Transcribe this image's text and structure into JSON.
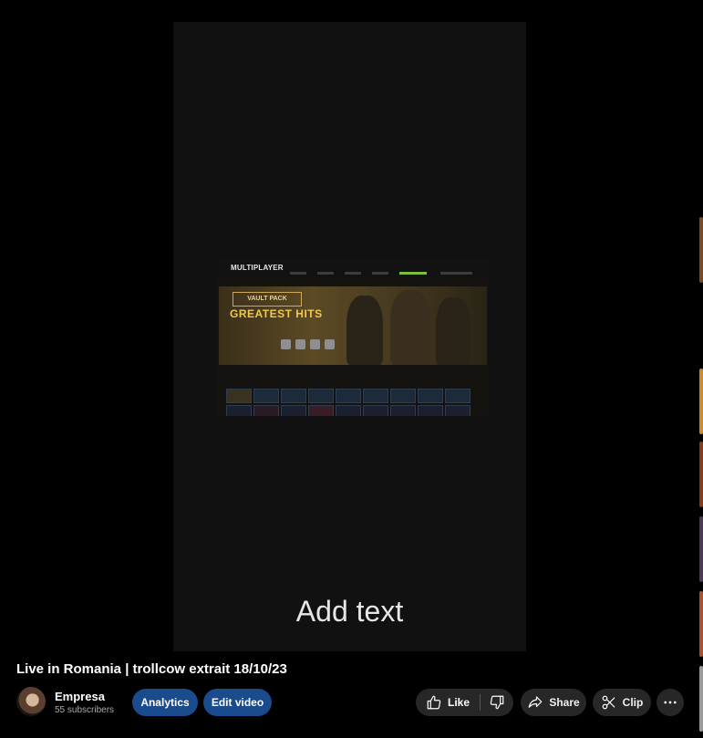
{
  "player": {
    "caption": "Add text",
    "thumbnail": {
      "mode_title": "MULTIPLAYER",
      "banner_badge": "VAULT PACK",
      "banner_title": "GREATEST HITS"
    }
  },
  "video": {
    "title": "Live in Romania | trollcow extrait 18/10/23"
  },
  "channel": {
    "name": "Empresa",
    "subscribers": "55 subscribers"
  },
  "actions": {
    "analytics_label": "Analytics",
    "edit_label": "Edit video",
    "like_label": "Like",
    "share_label": "Share",
    "clip_label": "Clip"
  },
  "icons": {
    "like": "thumbs-up-icon",
    "dislike": "thumbs-down-icon",
    "share": "share-arrow-icon",
    "clip": "scissors-icon",
    "more": "more-dots-icon"
  },
  "colors": {
    "primary_button": "#1a4b8c",
    "secondary_button": "#272727",
    "background": "#000000",
    "player_background": "#111111"
  }
}
